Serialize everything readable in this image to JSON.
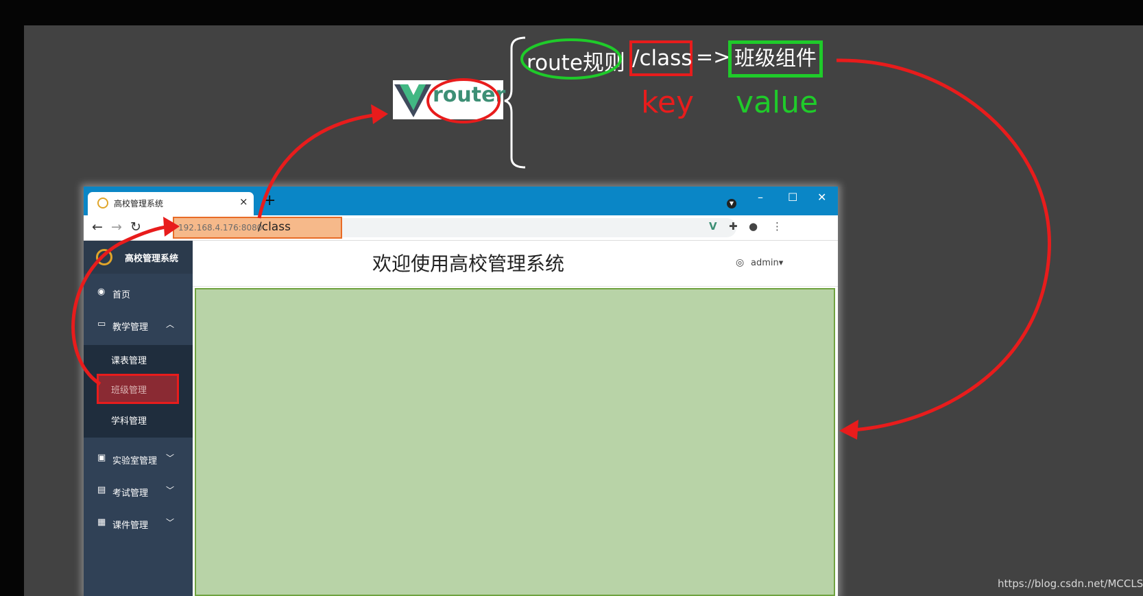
{
  "annotation": {
    "logo_text": "router",
    "rule_label": "route规则",
    "key_path": "/class",
    "arrow": "=>",
    "value_component": "班级组件",
    "key_word": "key",
    "value_word": "value",
    "colors": {
      "red": "#e81c1c",
      "green": "#1fcb2a"
    }
  },
  "browser": {
    "tab_title": "高校管理系统",
    "tab_close": "×",
    "new_tab": "+",
    "window_controls": {
      "minimize": "–",
      "maximize": "☐",
      "close": "✕"
    },
    "url_host": "192.168.4.176:8080",
    "url_path": "/class"
  },
  "app": {
    "sidebar_title": "高校管理系统",
    "menu": [
      {
        "label": "首页",
        "icon": "dashboard-icon"
      },
      {
        "label": "教学管理",
        "icon": "monitor-icon",
        "expanded": true
      },
      {
        "label": "实验室管理",
        "icon": "document-icon"
      },
      {
        "label": "考试管理",
        "icon": "clipboard-icon"
      },
      {
        "label": "课件管理",
        "icon": "word-file-icon"
      }
    ],
    "submenu": [
      {
        "label": "课表管理"
      },
      {
        "label": "班级管理",
        "active": true
      },
      {
        "label": "学科管理"
      }
    ],
    "page_title": "欢迎使用高校管理系统",
    "user_name": "admin"
  },
  "watermark": "https://blog.csdn.net/MCCLS"
}
